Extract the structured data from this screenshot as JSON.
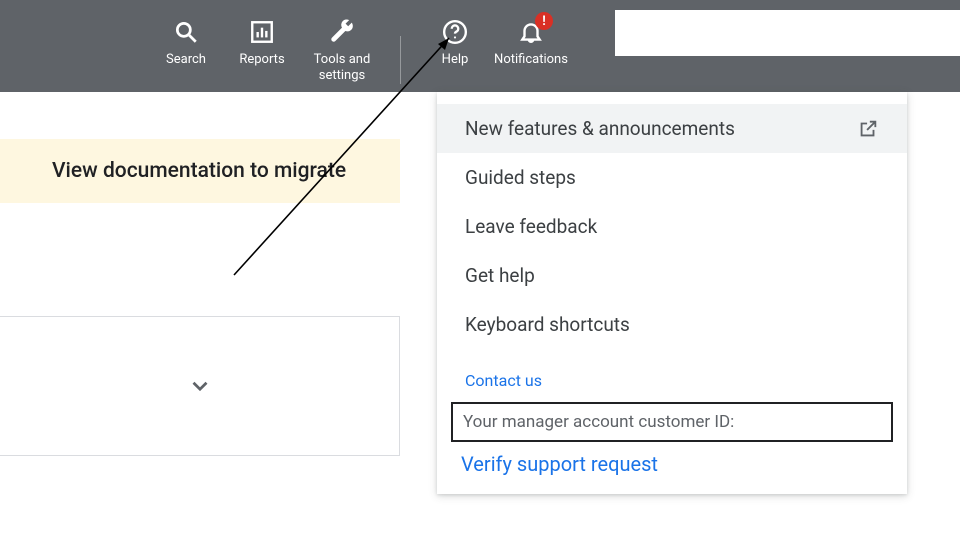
{
  "nav": {
    "search": {
      "label": "Search"
    },
    "reports": {
      "label": "Reports"
    },
    "tools": {
      "label": "Tools and settings"
    },
    "help": {
      "label": "Help"
    },
    "notif": {
      "label": "Notifications",
      "badge": "!"
    }
  },
  "banner": {
    "text": "View documentation to migrate"
  },
  "help_panel": {
    "items": [
      "New features & announcements",
      "Guided steps",
      "Leave feedback",
      "Get help",
      "Keyboard shortcuts"
    ],
    "contact_header": "Contact us",
    "customer_id_label": "Your manager account customer ID:",
    "verify_link": "Verify support request"
  }
}
